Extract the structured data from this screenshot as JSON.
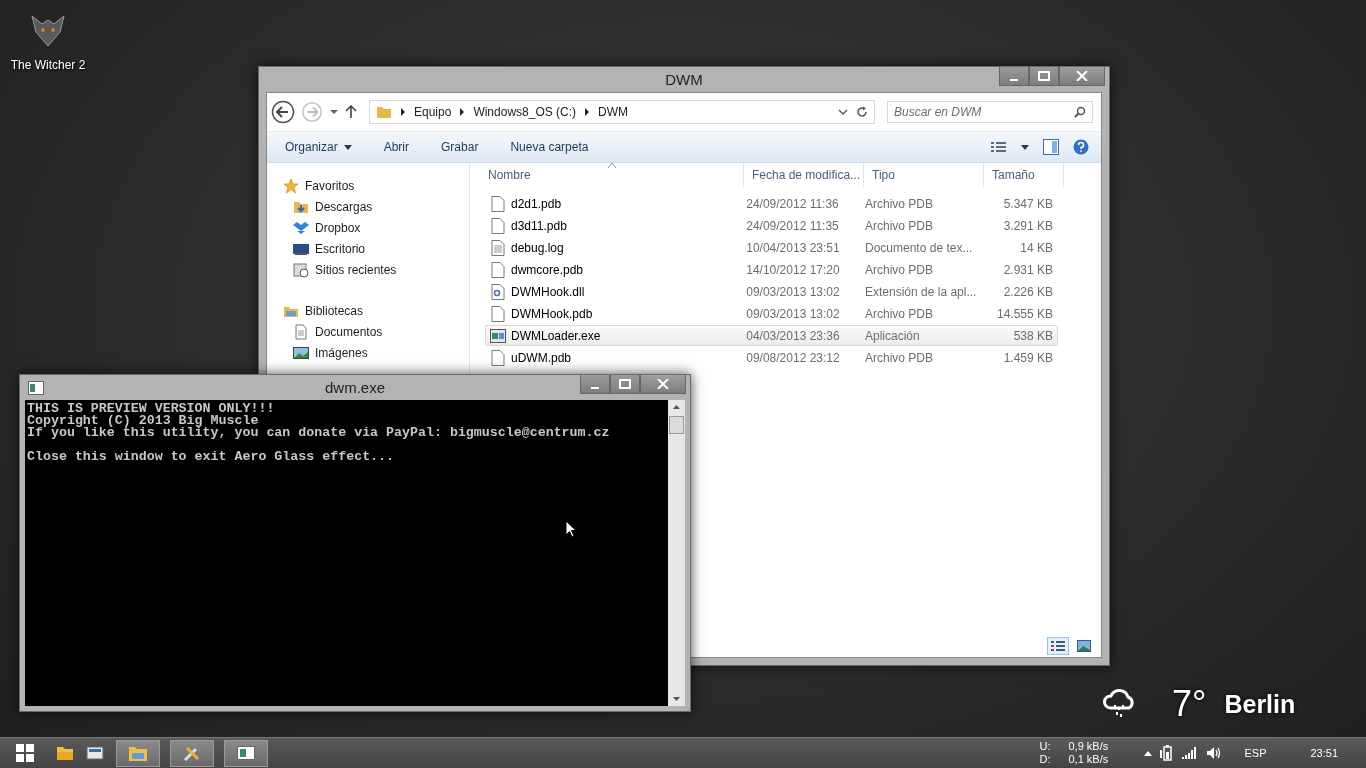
{
  "desktop_icons": [
    {
      "label": "The Witcher 2"
    }
  ],
  "explorer": {
    "title": "DWM",
    "breadcrumb": [
      "Equipo",
      "Windows8_OS (C:)",
      "DWM"
    ],
    "search": {
      "placeholder": "Buscar en DWM"
    },
    "commands": [
      {
        "label": "Organizar",
        "dropdown": true
      },
      {
        "label": "Abrir",
        "dropdown": false
      },
      {
        "label": "Grabar",
        "dropdown": false
      },
      {
        "label": "Nueva carpeta",
        "dropdown": false
      }
    ],
    "sidebar": [
      {
        "label": "Favoritos",
        "kind": "star",
        "children": [
          {
            "label": "Descargas",
            "kind": "downloads"
          },
          {
            "label": "Dropbox",
            "kind": "dropbox"
          },
          {
            "label": "Escritorio",
            "kind": "desktop"
          },
          {
            "label": "Sitios recientes",
            "kind": "recent"
          }
        ]
      },
      {
        "label": "Bibliotecas",
        "kind": "library",
        "children": [
          {
            "label": "Documentos",
            "kind": "documents"
          },
          {
            "label": "Imágenes",
            "kind": "images"
          }
        ]
      }
    ],
    "columns": [
      "Nombre",
      "Fecha de modifica...",
      "Tipo",
      "Tamaño"
    ],
    "files": [
      {
        "name": "d2d1.pdb",
        "modified": "24/09/2012 11:36",
        "type": "Archivo PDB",
        "size": "5.347 KB",
        "kind": "blank",
        "selected": false
      },
      {
        "name": "d3d11.pdb",
        "modified": "24/09/2012 11:35",
        "type": "Archivo PDB",
        "size": "3.291 KB",
        "kind": "blank",
        "selected": false
      },
      {
        "name": "debug.log",
        "modified": "10/04/2013 23:51",
        "type": "Documento de tex...",
        "size": "14 KB",
        "kind": "text",
        "selected": false
      },
      {
        "name": "dwmcore.pdb",
        "modified": "14/10/2012 17:20",
        "type": "Archivo PDB",
        "size": "2.931 KB",
        "kind": "blank",
        "selected": false
      },
      {
        "name": "DWMHook.dll",
        "modified": "09/03/2013 13:02",
        "type": "Extensión de la apl...",
        "size": "2.226 KB",
        "kind": "dll",
        "selected": false
      },
      {
        "name": "DWMHook.pdb",
        "modified": "09/03/2013 13:02",
        "type": "Archivo PDB",
        "size": "14.555 KB",
        "kind": "blank",
        "selected": false
      },
      {
        "name": "DWMLoader.exe",
        "modified": "04/03/2013 23:36",
        "type": "Aplicación",
        "size": "538 KB",
        "kind": "exe",
        "selected": true
      },
      {
        "name": "uDWM.pdb",
        "modified": "09/08/2012 23:12",
        "type": "Archivo PDB",
        "size": "1.459 KB",
        "kind": "blank",
        "selected": false
      }
    ],
    "views": [
      {
        "kind": "details",
        "selected": true
      },
      {
        "kind": "tiles",
        "selected": false
      }
    ]
  },
  "console": {
    "title": "dwm.exe",
    "paragraphs": [
      [
        "THIS IS PREVIEW VERSION ONLY!!!",
        "Copyright (C) 2013 Big Muscle",
        "If you like this utility, you can donate via PayPal: bigmuscle@centrum.cz"
      ],
      [
        "Close this window to exit Aero Glass effect..."
      ]
    ]
  },
  "weather": {
    "temperature": "7°",
    "city": "Berlin"
  },
  "taskbar": {
    "pinned": [
      {
        "kind": "folder"
      },
      {
        "kind": "drive"
      }
    ],
    "tasks": [
      {
        "kind": "explorer"
      },
      {
        "kind": "tools"
      },
      {
        "kind": "console"
      }
    ],
    "upload_label": "U:",
    "upload": "0,9 kB/s",
    "download_label": "D:",
    "download": "0,1 kB/s",
    "language": "ESP",
    "time": "23:51"
  }
}
